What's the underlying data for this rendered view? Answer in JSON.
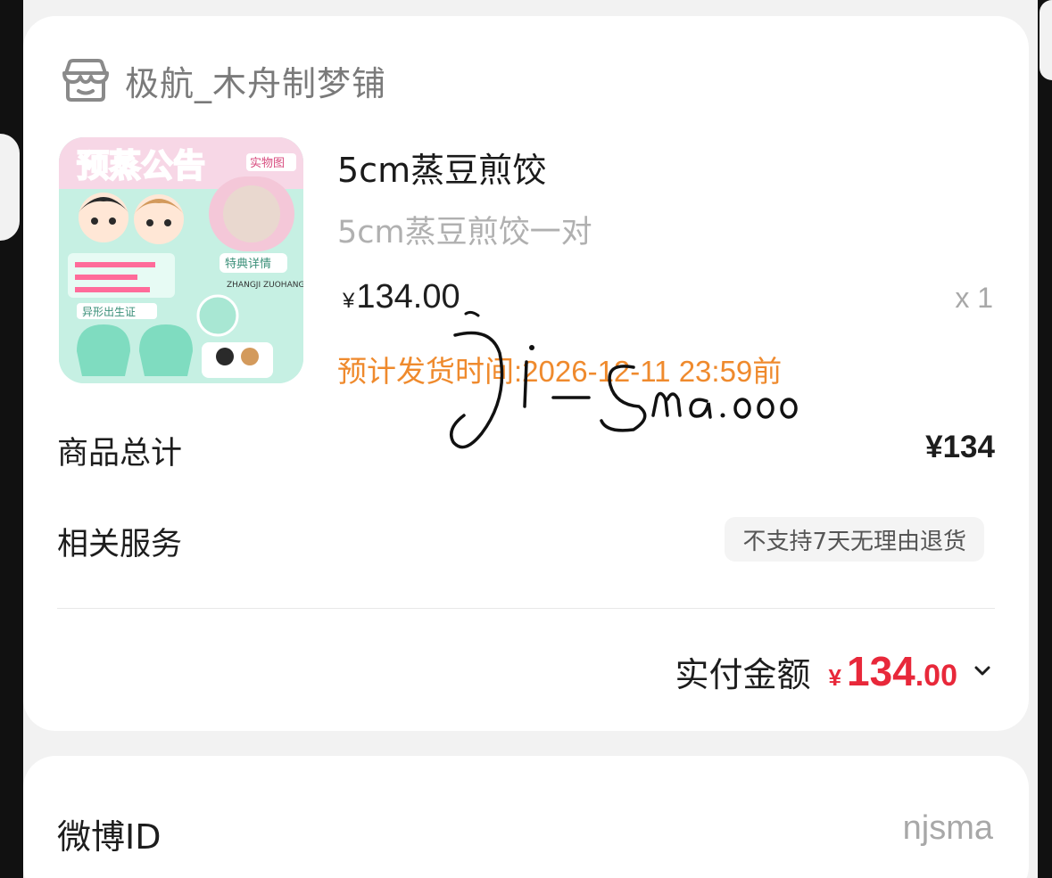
{
  "shop": {
    "name": "极航_木舟制梦铺",
    "icon": "store-icon"
  },
  "product": {
    "title": "5cm蒸豆煎饺",
    "variant": "5cm蒸豆煎饺一对",
    "price_symbol": "¥",
    "price": "134.00",
    "quantity": "x 1",
    "ship_note": "预计发货时间:2026-12-11 23:59前",
    "thumbnail": {
      "banner_text": "预蒸公告",
      "tag_photo": "实物图",
      "tag_details": "特典详情",
      "tag_birth": "异形出生证",
      "caption_en": "ZHANGJI ZUOHANG"
    }
  },
  "summary": {
    "subtotal_label": "商品总计",
    "subtotal_value": "¥134",
    "service_label": "相关服务",
    "service_badge": "不支持7天无理由退货",
    "paid_label": "实付金额",
    "paid_symbol": "¥",
    "paid_int": "134",
    "paid_dec": ".00"
  },
  "info": {
    "weibo_label": "微博ID",
    "weibo_value": "njsma"
  },
  "watermark": {
    "text": "Ji-Sma.000"
  },
  "colors": {
    "accent_orange": "#ef8a2d",
    "price_red": "#e8283a",
    "muted": "#a8a8a8",
    "thumb_bg": "#c6f0e3"
  }
}
